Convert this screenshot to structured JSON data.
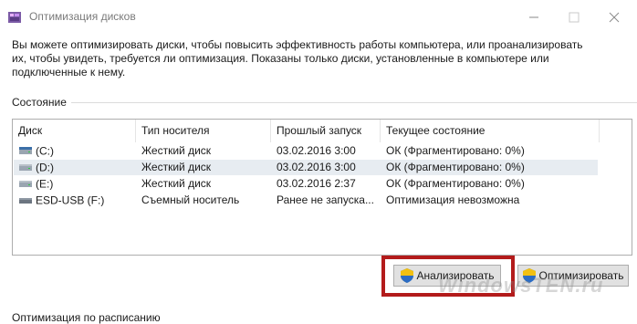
{
  "window": {
    "title": "Оптимизация дисков"
  },
  "description": "Вы можете оптимизировать диски, чтобы повысить эффективность работы  компьютера, или проанализировать их, чтобы увидеть, требуется ли оптимизация. Показаны только диски, установленные в компьютере или подключенные к нему.",
  "status_section": {
    "label": "Состояние"
  },
  "table": {
    "columns": [
      "Диск",
      "Тип носителя",
      "Прошлый запуск",
      "Текущее состояние"
    ],
    "rows": [
      {
        "drive": "(C:)",
        "media": "Жесткий диск",
        "last_run": "03.02.2016 3:00",
        "state": "ОК (Фрагментировано: 0%)",
        "icon": "hard-drive-icon",
        "selected": false
      },
      {
        "drive": "(D:)",
        "media": "Жесткий диск",
        "last_run": "03.02.2016 3:00",
        "state": "ОК (Фрагментировано: 0%)",
        "icon": "hard-drive-icon",
        "selected": true
      },
      {
        "drive": "(E:)",
        "media": "Жесткий диск",
        "last_run": "03.02.2016 2:37",
        "state": "ОК (Фрагментировано: 0%)",
        "icon": "hard-drive-icon",
        "selected": false
      },
      {
        "drive": "ESD-USB (F:)",
        "media": "Съемный носитель",
        "last_run": "Ранее не запуска...",
        "state": "Оптимизация невозможна",
        "icon": "usb-drive-icon",
        "selected": false
      }
    ]
  },
  "buttons": {
    "analyze": "Анализировать",
    "optimize": "Оптимизировать"
  },
  "schedule_section": {
    "label": "Оптимизация по расписанию"
  },
  "watermark": "WindowsTEN.ru",
  "colors": {
    "highlight_border": "#b31b1b",
    "selected_row": "#e7ecf1",
    "button_bg": "#e1e1e1"
  }
}
